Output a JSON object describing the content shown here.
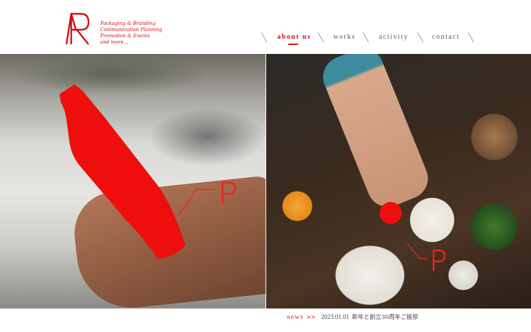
{
  "brand": {
    "logo_icon": "ra-monogram-logo",
    "tagline": [
      "Packaging & Branding",
      "Communication Planning",
      "Promotion & Events",
      "and more..."
    ],
    "accent_color": "#d40f14"
  },
  "nav": {
    "items": [
      {
        "label": "about us",
        "active": true
      },
      {
        "label": "works",
        "active": false
      },
      {
        "label": "activity",
        "active": false
      },
      {
        "label": "contact",
        "active": false
      }
    ]
  },
  "hero": {
    "left_image": "hand-holding-red-bottle-photo",
    "right_image": "food-table-overhead-photo",
    "mark_icon": "red-p-mark-icon"
  },
  "news": {
    "label": "news",
    "arrow": ">>",
    "date": "2023.01.01",
    "text": "新年と創立30周年ご挨拶"
  }
}
